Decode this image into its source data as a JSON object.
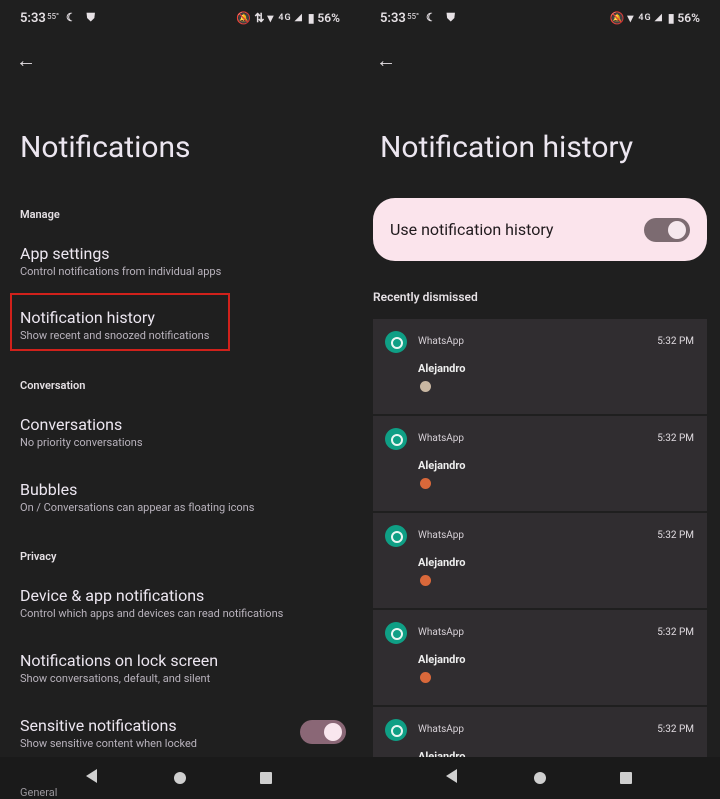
{
  "left": {
    "status": {
      "time": "5:33",
      "temp": "55°",
      "left_icons": "☾ ⛊",
      "right_icons": "🔕 ⇅ ▾",
      "signal": "4G ◢",
      "battery": "▮ 56%"
    },
    "title": "Notifications",
    "sections": {
      "manage": "Manage",
      "conversation": "Conversation",
      "privacy": "Privacy",
      "general": "General"
    },
    "items": {
      "app_settings": {
        "title": "App settings",
        "subtitle": "Control notifications from individual apps"
      },
      "notification_history": {
        "title": "Notification history",
        "subtitle": "Show recent and snoozed notifications"
      },
      "conversations": {
        "title": "Conversations",
        "subtitle": "No priority conversations"
      },
      "bubbles": {
        "title": "Bubbles",
        "subtitle": "On / Conversations can appear as floating icons"
      },
      "device_app": {
        "title": "Device & app notifications",
        "subtitle": "Control which apps and devices can read notifications"
      },
      "lock_screen": {
        "title": "Notifications on lock screen",
        "subtitle": "Show conversations, default, and silent"
      },
      "sensitive": {
        "title": "Sensitive notifications",
        "subtitle": "Show sensitive content when locked",
        "enabled": true
      }
    }
  },
  "right": {
    "status": {
      "time": "5:33",
      "temp": "55°",
      "left_icons": "☾ ⛊",
      "right_icons": "🔕 ▾",
      "signal": "4G ◢",
      "battery": "▮ 56%"
    },
    "title": "Notification history",
    "use_history": {
      "label": "Use notification history",
      "enabled": true
    },
    "recent_label": "Recently dismissed",
    "notifications": [
      {
        "app": "WhatsApp",
        "time": "5:32 PM",
        "sender": "Alejandro"
      },
      {
        "app": "WhatsApp",
        "time": "5:32 PM",
        "sender": "Alejandro"
      },
      {
        "app": "WhatsApp",
        "time": "5:32 PM",
        "sender": "Alejandro"
      },
      {
        "app": "WhatsApp",
        "time": "5:32 PM",
        "sender": "Alejandro"
      },
      {
        "app": "WhatsApp",
        "time": "5:32 PM",
        "sender": "Alejandro"
      }
    ]
  },
  "colors": {
    "background": "#1f1f1f",
    "highlight_border": "#d0211b",
    "pink_card": "#fbe4ec",
    "whatsapp": "#0f9f85"
  }
}
